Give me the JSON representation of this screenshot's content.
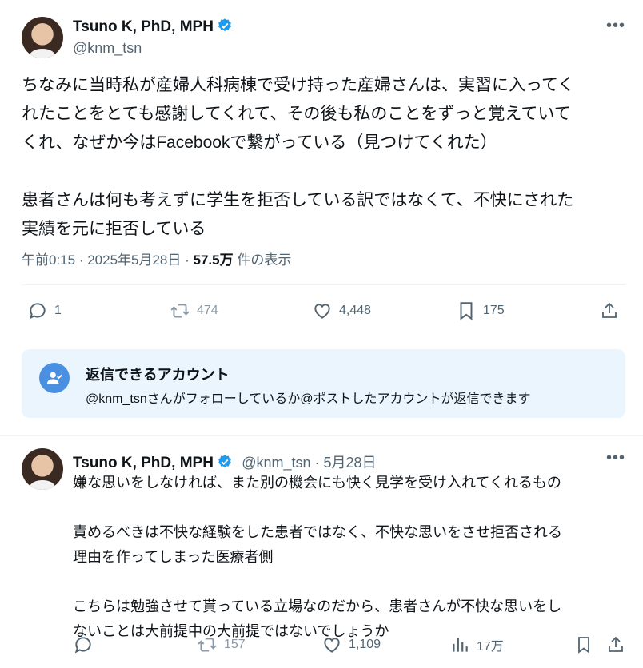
{
  "main_tweet": {
    "author_name": "Tsuno K, PhD, MPH",
    "handle": "@knm_tsn",
    "more_icon": "more-horizontal-icon",
    "text": "ちなみに当時私が産婦人科病棟で受け持った産婦さんは、実習に入ってく\nれたことをとても感謝してくれて、その後も私のことをずっと覚えていて\nくれ、なぜか今はFacebookで繋がっている（見つけてくれた）\n\n患者さんは何も考えずに学生を拒否している訳ではなくて、不快にされた\n実績を元に拒否している",
    "time": "午前0:15",
    "date": "2025年5月28日",
    "views_count": "57.5万",
    "views_label": "件の表示",
    "actions": {
      "replies": "1",
      "reposts": "474",
      "likes": "4,448",
      "bookmarks": "175"
    }
  },
  "reply_restriction": {
    "title": "返信できるアカウント",
    "description": "@knm_tsnさんがフォローしているか@ポストしたアカウントが返信できます"
  },
  "reply_tweet": {
    "author_name": "Tsuno K, PhD, MPH",
    "handle": "@knm_tsn",
    "date": "5月28日",
    "text": "嫌な思いをしなければ、また別の機会にも快く見学を受け入れてくれるもの\n\n責めるべきは不快な経験をした患者ではなく、不快な思いをさせ拒否される\n理由を作ってしまった医療者側\n\nこちらは勉強させて貰っている立場なのだから、患者さんが不快な思いをし\nないことは大前提中の大前提ではないでしょうか",
    "actions": {
      "replies": "",
      "reposts": "157",
      "likes": "1,109",
      "views": "17万"
    }
  },
  "colors": {
    "text": "#0f1419",
    "secondary": "#536471",
    "accent": "#1d9bf0",
    "banner_bg": "#eaf5fd"
  }
}
